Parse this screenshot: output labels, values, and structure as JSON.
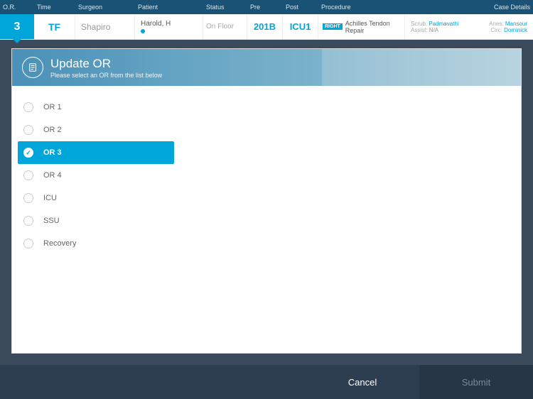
{
  "headers": {
    "or": "O.R.",
    "time": "Time",
    "surgeon": "Surgeon",
    "patient": "Patient",
    "status": "Status",
    "pre": "Pre",
    "post": "Post",
    "procedure": "Procedure",
    "caseDetails": "Case Details"
  },
  "caseRow": {
    "or": "3",
    "time": "TF",
    "surgeon": "Shapiro",
    "patient": "Harold, H",
    "status": "On Floor",
    "pre": "201B",
    "post": "ICU1",
    "side": "RIGHT",
    "procedure": "Achilles Tendon Repair",
    "details": {
      "scrubLabel": "Scrub:",
      "scrub": "Padmavathi",
      "assistLabel": "Assist:",
      "assist": "N/A",
      "anesLabel": "Anes:",
      "anes": "Mansour",
      "circLabel": "Circ:",
      "circ": "Dominick"
    }
  },
  "modal": {
    "title": "Update OR",
    "subtitle": "Please select an OR from the list below"
  },
  "orOptions": [
    {
      "label": "OR 1",
      "selected": false
    },
    {
      "label": "OR 2",
      "selected": false
    },
    {
      "label": "OR 3",
      "selected": true
    },
    {
      "label": "OR 4",
      "selected": false
    },
    {
      "label": "ICU",
      "selected": false
    },
    {
      "label": "SSU",
      "selected": false
    },
    {
      "label": "Recovery",
      "selected": false
    }
  ],
  "actions": {
    "cancel": "Cancel",
    "submit": "Submit"
  }
}
